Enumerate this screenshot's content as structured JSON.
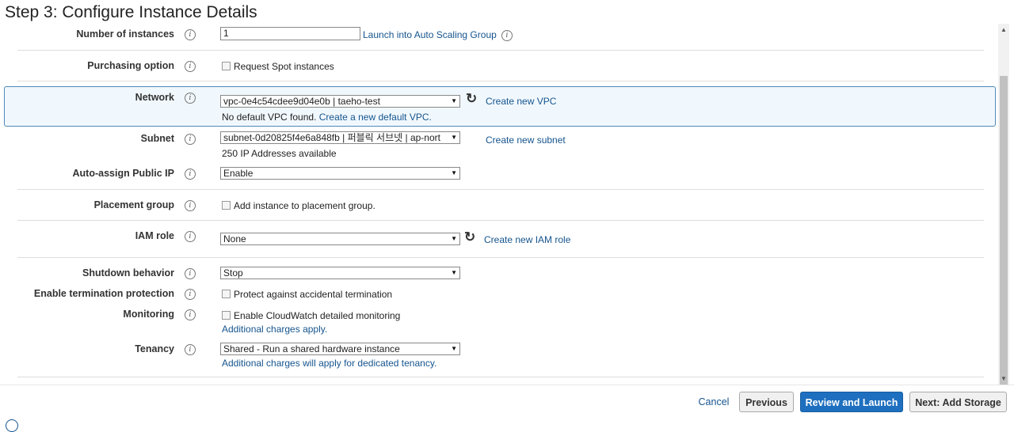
{
  "title": "Step 3: Configure Instance Details",
  "info_glyph": "i",
  "rows": {
    "instances": {
      "label": "Number of instances",
      "value": "1",
      "link": "Launch into Auto Scaling Group"
    },
    "purchasing": {
      "label": "Purchasing option",
      "checkbox": "Request Spot instances"
    },
    "network": {
      "label": "Network",
      "selected": "vpc-0e4c54cdee9d04e0b | taeho-test",
      "link": "Create new VPC",
      "note": "No default VPC found.",
      "note_link": "Create a new default VPC."
    },
    "subnet": {
      "label": "Subnet",
      "selected": "subnet-0d20825f4e6a848fb | 퍼블릭 서브넷 | ap-nort",
      "link": "Create new subnet",
      "note": "250 IP Addresses available"
    },
    "auto_ip": {
      "label": "Auto-assign Public IP",
      "selected": "Enable"
    },
    "placement": {
      "label": "Placement group",
      "checkbox": "Add instance to placement group."
    },
    "iam": {
      "label": "IAM role",
      "selected": "None",
      "link": "Create new IAM role"
    },
    "shutdown": {
      "label": "Shutdown behavior",
      "selected": "Stop"
    },
    "termination": {
      "label": "Enable termination protection",
      "checkbox": "Protect against accidental termination"
    },
    "monitoring": {
      "label": "Monitoring",
      "checkbox": "Enable CloudWatch detailed monitoring",
      "note_link": "Additional charges apply."
    },
    "tenancy": {
      "label": "Tenancy",
      "selected": "Shared - Run a shared hardware instance",
      "note_link": "Additional charges will apply for dedicated tenancy."
    }
  },
  "buttons": {
    "cancel": "Cancel",
    "previous": "Previous",
    "review": "Review and Launch",
    "next": "Next: Add Storage"
  },
  "colors": {
    "link": "#15548e",
    "primary": "#1e6fbf",
    "highlight_border": "#4f89b7"
  }
}
